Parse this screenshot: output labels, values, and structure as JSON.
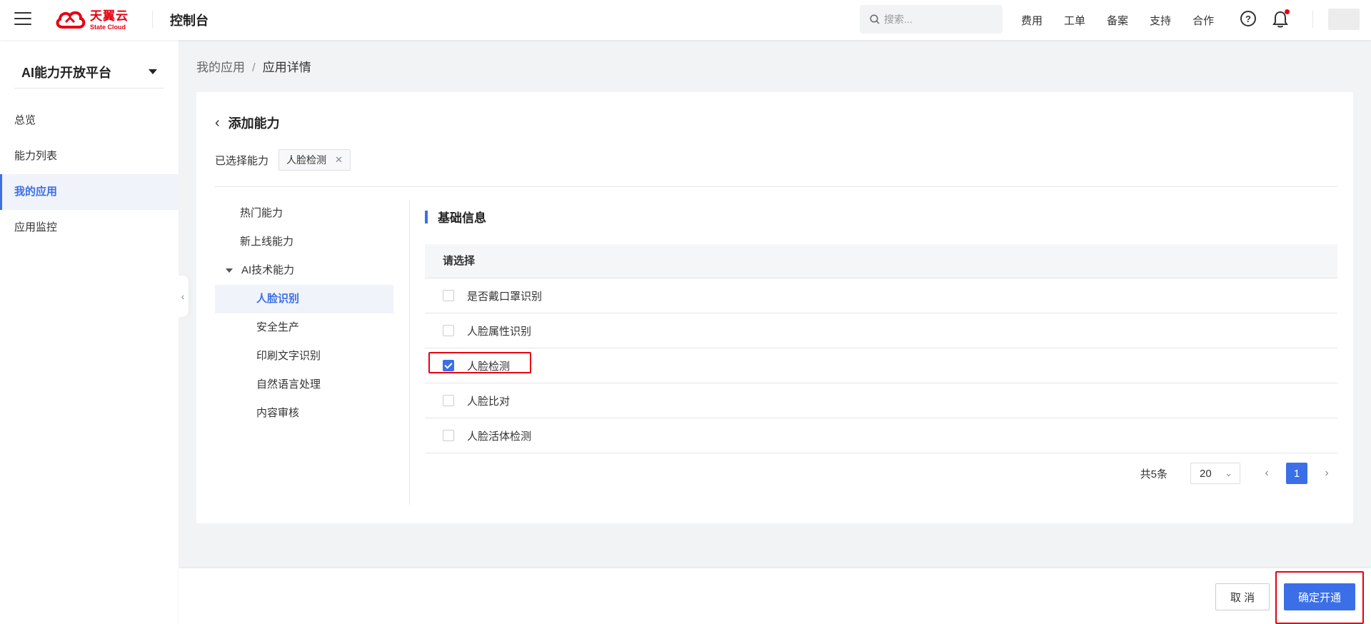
{
  "header": {
    "logo_cn": "天翼云",
    "logo_en": "State Cloud",
    "console_title": "控制台",
    "search_placeholder": "搜索...",
    "nav": [
      "费用",
      "工单",
      "备案",
      "支持",
      "合作"
    ],
    "help_icon": "question-circle-icon",
    "bell_icon": "bell-icon",
    "notification_dot_color": "#e60012"
  },
  "sidebar": {
    "platform_label": "AI能力开放平台",
    "items": [
      {
        "label": "总览",
        "active": false
      },
      {
        "label": "能力列表",
        "active": false
      },
      {
        "label": "我的应用",
        "active": true
      },
      {
        "label": "应用监控",
        "active": false
      }
    ]
  },
  "breadcrumb": {
    "parent": "我的应用",
    "separator": "/",
    "current": "应用详情"
  },
  "card": {
    "title": "添加能力",
    "selected_label": "已选择能力",
    "selected_tags": [
      "人脸检测"
    ]
  },
  "categories": {
    "items": [
      {
        "label": "热门能力"
      },
      {
        "label": "新上线能力"
      },
      {
        "label": "AI技术能力"
      }
    ],
    "subitems": [
      {
        "label": "人脸识别",
        "active": true
      },
      {
        "label": "安全生产"
      },
      {
        "label": "印刷文字识别"
      },
      {
        "label": "自然语言处理"
      },
      {
        "label": "内容审核"
      }
    ]
  },
  "section": {
    "title": "基础信息",
    "list_header": "请选择",
    "rows": [
      {
        "label": "是否戴口罩识别",
        "checked": false
      },
      {
        "label": "人脸属性识别",
        "checked": false
      },
      {
        "label": "人脸检测",
        "checked": true
      },
      {
        "label": "人脸比对",
        "checked": false
      },
      {
        "label": "人脸活体检测",
        "checked": false
      }
    ]
  },
  "pagination": {
    "total": "共5条",
    "page_size": "20",
    "current_page": "1"
  },
  "footer": {
    "cancel_label": "取 消",
    "confirm_label": "确定开通"
  },
  "colors": {
    "accent": "#3b6fe8",
    "brand_red": "#e60012",
    "highlight_box": "#e60012"
  }
}
